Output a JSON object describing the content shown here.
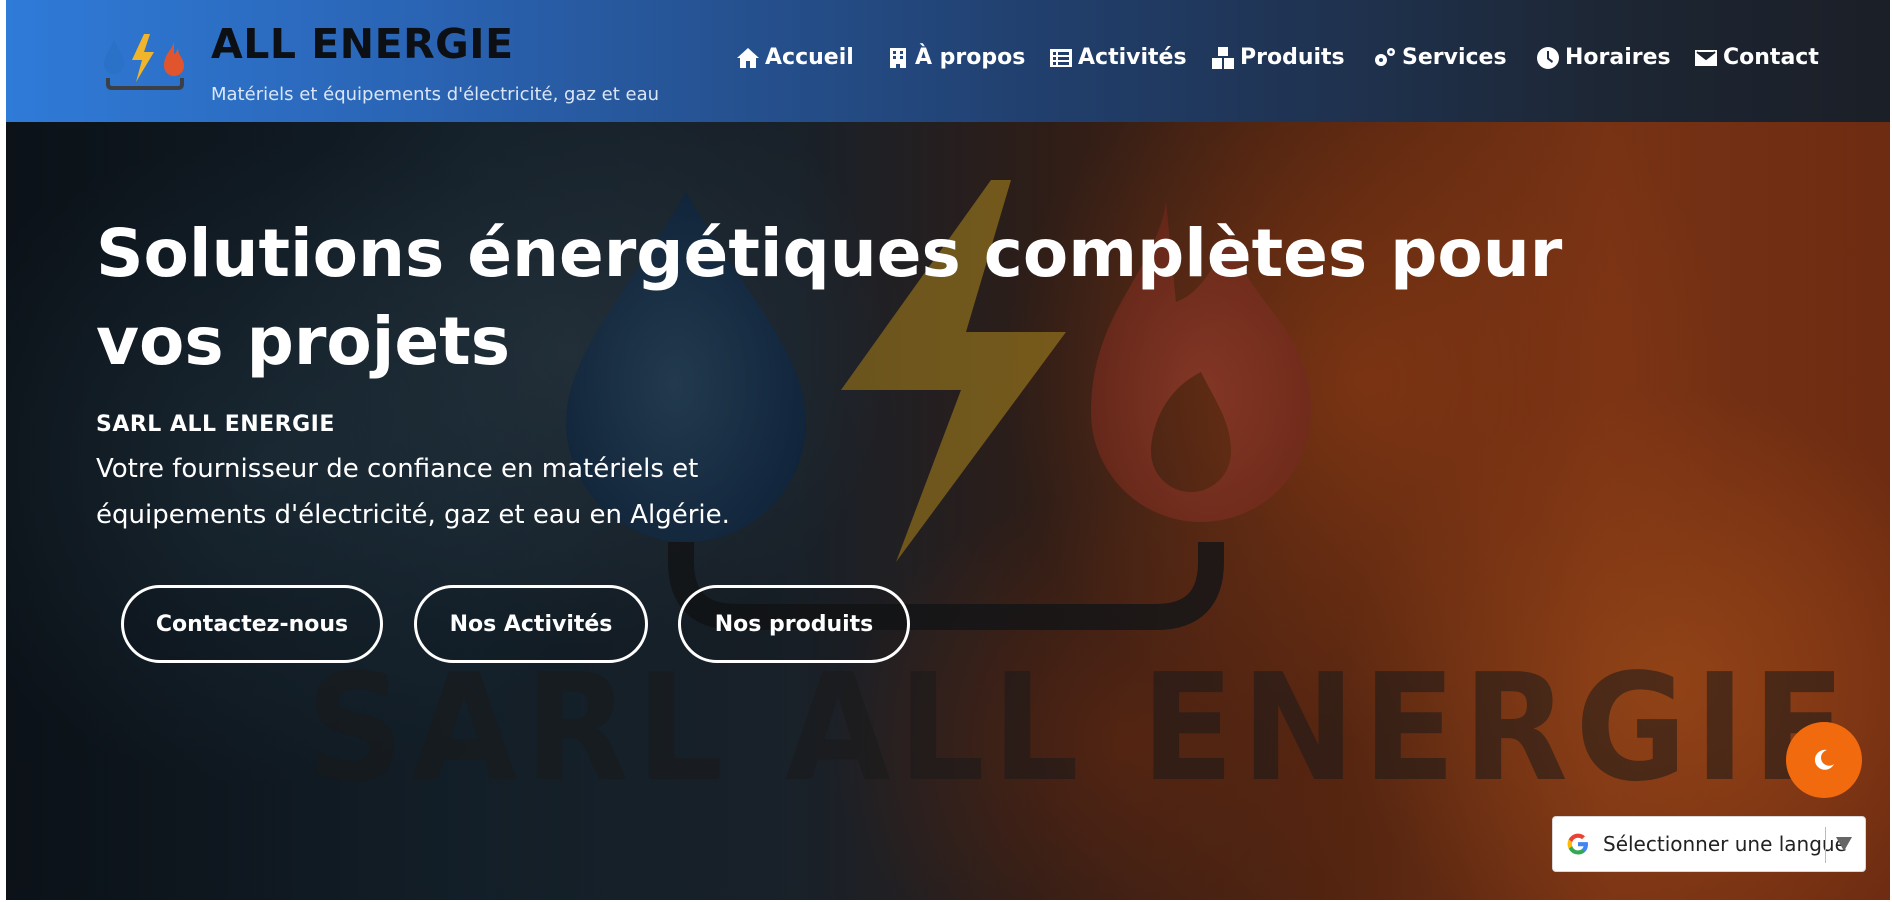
{
  "header": {
    "brand": "ALL ENERGIE",
    "tagline": "Matériels et équipements d'électricité, gaz et eau",
    "logo_icon": "water-bolt-flame-logo",
    "nav": [
      {
        "label": "Accueil",
        "icon": "home-icon"
      },
      {
        "label": "À propos",
        "icon": "building-icon"
      },
      {
        "label": "Activités",
        "icon": "list-icon"
      },
      {
        "label": "Produits",
        "icon": "boxes-icon"
      },
      {
        "label": "Services",
        "icon": "gears-icon"
      },
      {
        "label": "Horaires",
        "icon": "clock-icon"
      },
      {
        "label": "Contact",
        "icon": "envelope-icon"
      }
    ]
  },
  "hero": {
    "title": "Solutions énergétiques complètes pour vos projets",
    "company": "SARL ALL ENERGIE",
    "description": "Votre fournisseur de confiance en matériels et équipements d'électricité, gaz et eau en Algérie.",
    "watermark": "SARL ALL ENERGIE",
    "buttons": [
      "Contactez-nous",
      "Nos Activités",
      "Nos produits"
    ]
  },
  "widgets": {
    "theme_toggle_icon": "moon-icon",
    "language_select": "Sélectionner une langue"
  },
  "colors": {
    "header_start": "#2f7bd8",
    "header_end": "#1b1f27",
    "accent_orange": "#f26a0e",
    "water_blue": "#1f4f8a",
    "bolt_yellow": "#e8b526",
    "flame_red": "#c8452a"
  }
}
